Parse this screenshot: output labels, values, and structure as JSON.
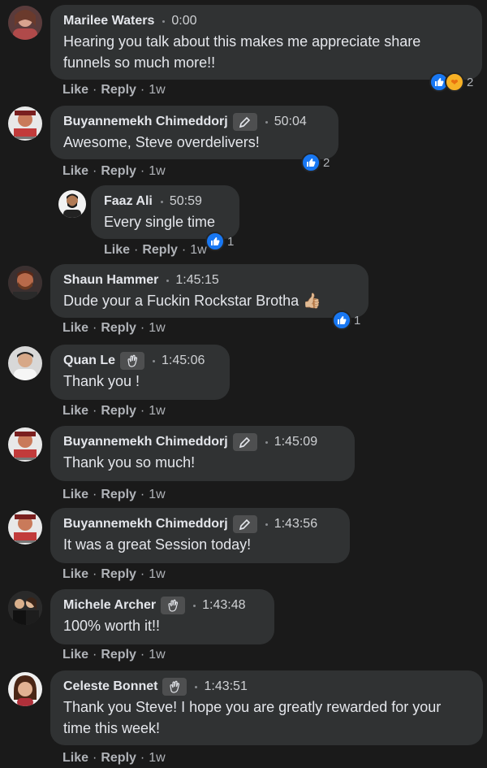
{
  "actions": {
    "like_label": "Like",
    "reply_label": "Reply",
    "separator": "·"
  },
  "comments": [
    {
      "name": "Marilee Waters",
      "time": "0:00",
      "text": "Hearing you talk about this makes me appreciate share funnels so much more!!",
      "ago": "1w",
      "reaction_count": "2",
      "reactions": [
        "like-icon",
        "care-icon"
      ]
    },
    {
      "name": "Buyannemekh Chimeddorj",
      "badge": "pen-icon",
      "time": "50:04",
      "text": "Awesome, Steve overdelivers!",
      "ago": "1w",
      "reaction_count": "2",
      "reactions": [
        "like-icon"
      ]
    },
    {
      "name": "Faaz Ali",
      "time": "50:59",
      "text": "Every single time",
      "ago": "1w",
      "reaction_count": "1",
      "reactions": [
        "like-icon"
      ]
    },
    {
      "name": "Shaun Hammer",
      "time": "1:45:15",
      "text": "Dude your a Fuckin Rockstar Brotha 👍🏼",
      "ago": "1w",
      "reaction_count": "1",
      "reactions": [
        "like-icon"
      ]
    },
    {
      "name": "Quan Le",
      "badge": "wave-icon",
      "time": "1:45:06",
      "text": "Thank you !",
      "ago": "1w"
    },
    {
      "name": "Buyannemekh Chimeddorj",
      "badge": "pen-icon",
      "time": "1:45:09",
      "text": "Thank you so much!",
      "ago": "1w"
    },
    {
      "name": "Buyannemekh Chimeddorj",
      "badge": "pen-icon",
      "time": "1:43:56",
      "text": "It was a great Session today!",
      "ago": "1w"
    },
    {
      "name": "Michele Archer",
      "badge": "wave-icon",
      "time": "1:43:48",
      "text": "100% worth it!!",
      "ago": "1w"
    },
    {
      "name": "Celeste Bonnet",
      "badge": "wave-icon",
      "time": "1:43:51",
      "text": "Thank you Steve! I hope you are greatly rewarded for your time this week!",
      "ago": "1w"
    }
  ]
}
